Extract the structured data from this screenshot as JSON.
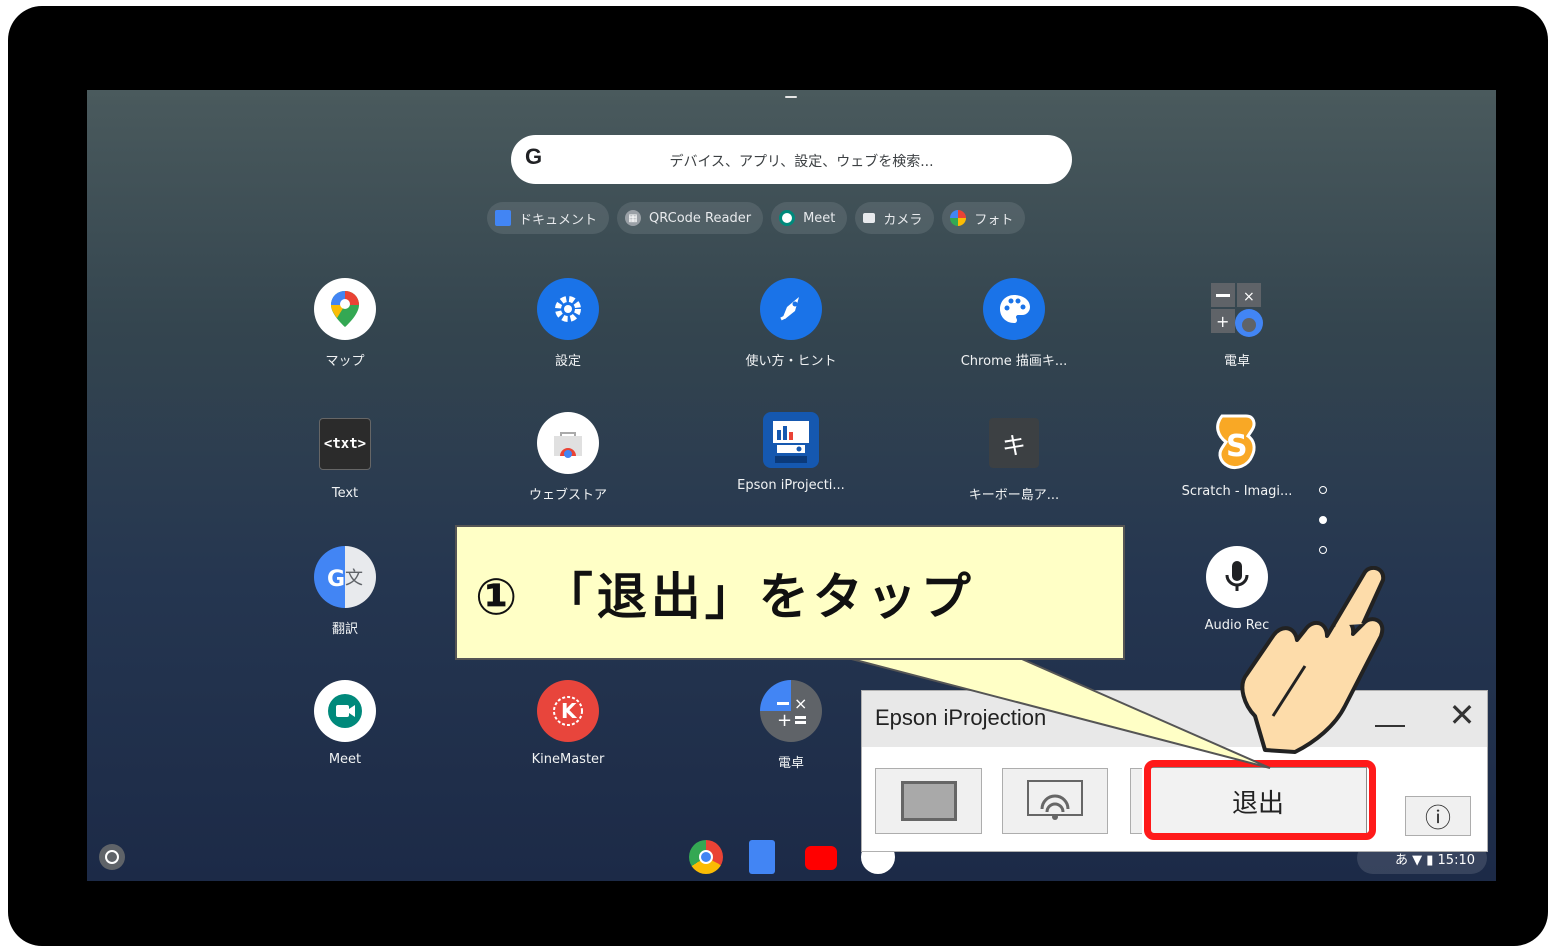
{
  "search": {
    "placeholder": "デバイス、アプリ、設定、ウェブを検索..."
  },
  "chips": [
    {
      "label": "ドキュメント",
      "color": "#4285f4"
    },
    {
      "label": "QRCode Reader",
      "color": "#5f6368"
    },
    {
      "label": "Meet",
      "color": "#00897b"
    },
    {
      "label": "カメラ",
      "color": "#1a73e8"
    },
    {
      "label": "フォト",
      "color": "#fbbc04"
    }
  ],
  "apps": [
    {
      "label": "マップ"
    },
    {
      "label": "設定"
    },
    {
      "label": "使い方・ヒント"
    },
    {
      "label": "Chrome 描画キ..."
    },
    {
      "label": "電卓"
    },
    {
      "label": "Text"
    },
    {
      "label": "ウェブストア"
    },
    {
      "label": "Epson iProjecti..."
    },
    {
      "label": "キーボー島ア..."
    },
    {
      "label": "Scratch - Imagi..."
    },
    {
      "label": "翻訳"
    },
    {
      "label": "Audio Rec"
    },
    {
      "label": "Meet"
    },
    {
      "label": "KineMaster"
    },
    {
      "label": "電卓"
    }
  ],
  "icons": {
    "textapp": "<txt>",
    "keyboard": "キ"
  },
  "tray": {
    "text": "あ ▼ ▮ 15:10"
  },
  "epson_window": {
    "title": "Epson iProjection",
    "exit_label": "退出",
    "info_label": "ⓘ",
    "close_label": "✕"
  },
  "callout": {
    "text": "① 「退出」をタップ"
  },
  "colors": {
    "highlight": "#ff1a1a",
    "callout_bg": "#ffffc6"
  }
}
